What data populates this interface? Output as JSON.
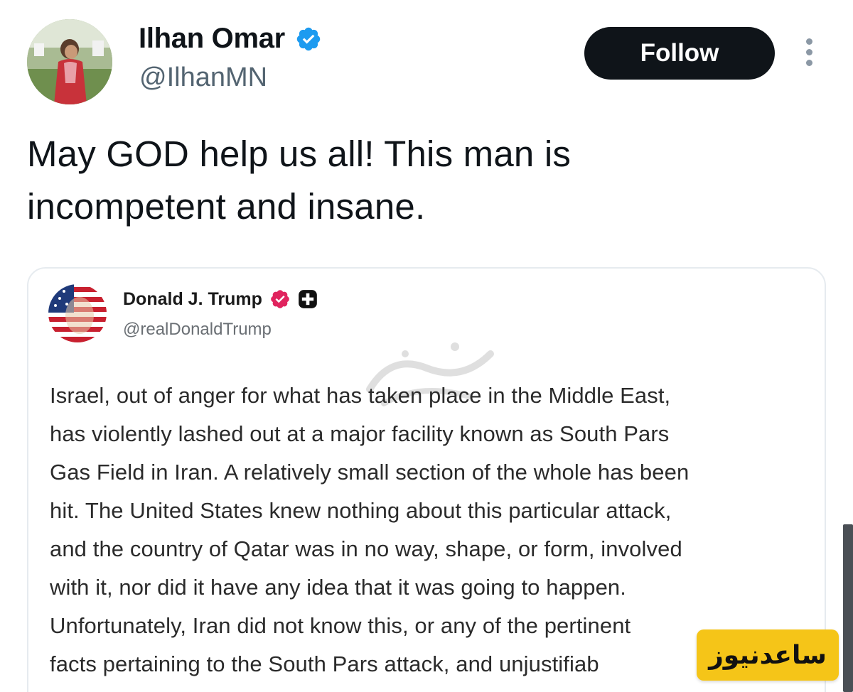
{
  "tweet": {
    "author": {
      "display_name": "Ilhan Omar",
      "handle": "@IlhanMN",
      "verified_icon": "verified-badge-icon",
      "verified_color": "#1d9bf0"
    },
    "follow_label": "Follow",
    "more_icon": "more-options-icon",
    "text_line_1": "May GOD help us all! This man is",
    "text_line_2": "incompetent and insane."
  },
  "quoted_post": {
    "author": {
      "display_name": "Donald J. Trump",
      "handle": "@realDonaldTrump",
      "badge_color": "#e0245e"
    },
    "lines": [
      "Israel, out of anger for what has taken place in the Middle East,",
      "has violently lashed out at a major facility known as South Pars",
      "Gas Field in Iran. A relatively small section of the whole has been",
      "hit. The United States knew nothing about this particular attack,",
      "and the country of Qatar was in no way, shape, or form, involved",
      "with it, nor did it have any idea that it was going to happen.",
      "Unfortunately, Iran did not know this, or any of the pertinent",
      "facts pertaining to the South Pars attack, and unjustifiab"
    ]
  },
  "overlay": {
    "logo_text": "ساعدنیوز",
    "logo_color": "#f5c518"
  }
}
